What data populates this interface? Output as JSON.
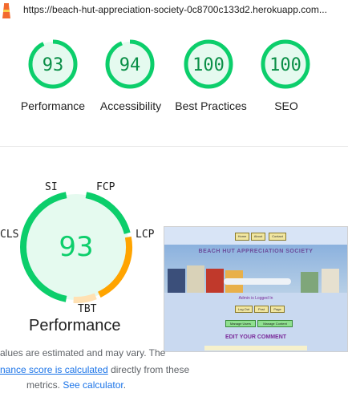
{
  "report": {
    "url": "https://beach-hut-appreciation-society-0c8700c133d2.herokuapp.com...",
    "logo_icon": "lighthouse-icon"
  },
  "scores": [
    {
      "value": "93",
      "label": "Performance",
      "color": "#0cce6b",
      "fraction": 0.93
    },
    {
      "value": "94",
      "label": "Accessibility",
      "color": "#0cce6b",
      "fraction": 0.94
    },
    {
      "value": "100",
      "label": "Best Practices",
      "color": "#0cce6b",
      "fraction": 1.0
    },
    {
      "value": "100",
      "label": "SEO",
      "color": "#0cce6b",
      "fraction": 1.0
    }
  ],
  "performance": {
    "score": "93",
    "title": "Performance",
    "metrics": [
      "SI",
      "FCP",
      "LCP",
      "TBT",
      "CLS"
    ],
    "colors": {
      "pass": "#0cce6b",
      "average": "#ffa400",
      "average_light": "#ffe1b3",
      "pass_bg": "#e5faef"
    }
  },
  "screenshot": {
    "nav": [
      "Home",
      "About",
      "Contact"
    ],
    "hero_title": "BEACH HUT APPRECIATION SOCIETY",
    "logged_in": "Admin is Logged In",
    "buttons": [
      "Log Out",
      "Post",
      "Page"
    ],
    "green_buttons": [
      "Manage Users",
      "Manage Content"
    ],
    "edit_heading": "EDIT YOUR COMMENT"
  },
  "note": {
    "line1": "alues are estimated and may vary. The",
    "link1": "nance score is calculated",
    "line2_rest": " directly from these",
    "line3_pre": "metrics. ",
    "link2": "See calculator",
    "line3_post": "."
  }
}
